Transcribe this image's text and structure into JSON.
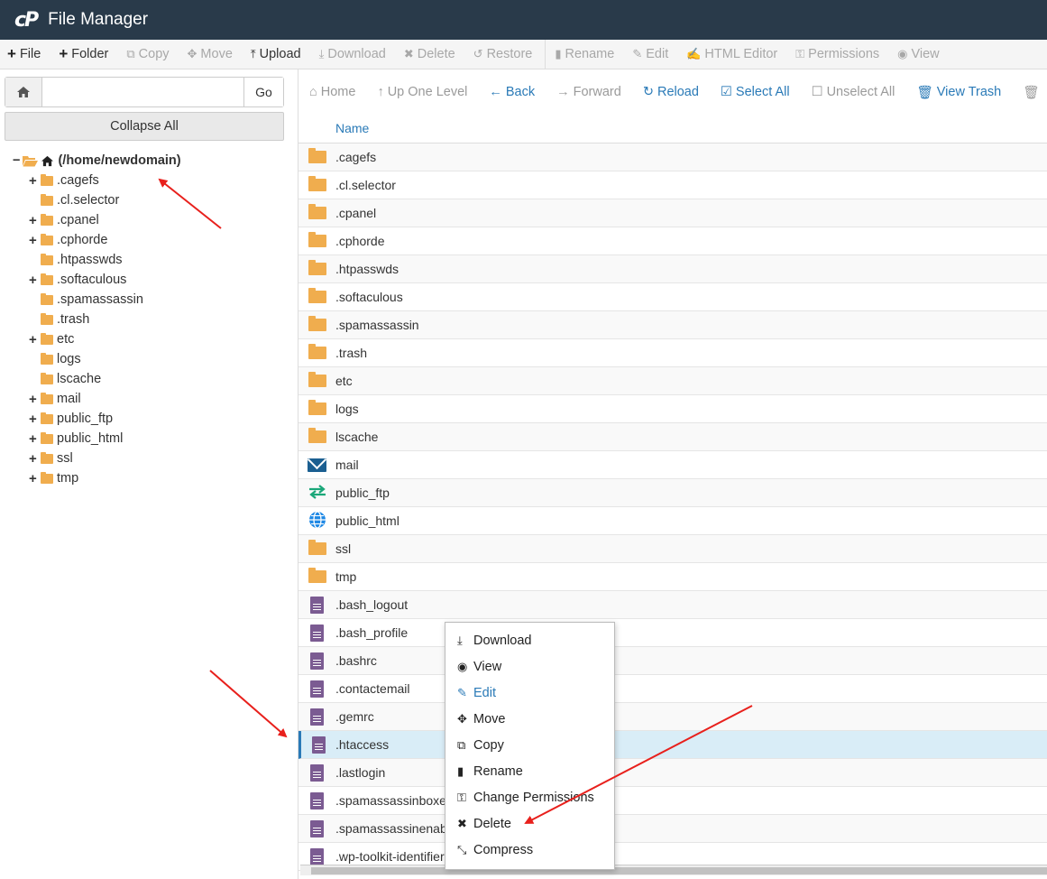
{
  "app": {
    "logo": "cP",
    "title": "File Manager"
  },
  "toolbar": [
    {
      "label": "File",
      "icon": "+",
      "disabled": false,
      "name": "new-file-button"
    },
    {
      "label": "Folder",
      "icon": "+",
      "disabled": false,
      "name": "new-folder-button"
    },
    {
      "label": "Copy",
      "icon": "⧉",
      "disabled": true,
      "name": "copy-button"
    },
    {
      "label": "Move",
      "icon": "✥",
      "disabled": true,
      "name": "move-button"
    },
    {
      "label": "Upload",
      "icon": "⤒",
      "disabled": false,
      "name": "upload-button"
    },
    {
      "label": "Download",
      "icon": "⤓",
      "disabled": true,
      "name": "download-button"
    },
    {
      "label": "Delete",
      "icon": "✖",
      "disabled": true,
      "name": "delete-button"
    },
    {
      "label": "Restore",
      "icon": "↺",
      "disabled": true,
      "name": "restore-button"
    },
    {
      "label": "Rename",
      "icon": "▮",
      "disabled": true,
      "name": "rename-button"
    },
    {
      "label": "Edit",
      "icon": "✎",
      "disabled": true,
      "name": "edit-button"
    },
    {
      "label": "HTML Editor",
      "icon": "✍",
      "disabled": true,
      "name": "html-editor-button"
    },
    {
      "label": "Permissions",
      "icon": "⚿",
      "disabled": true,
      "name": "permissions-button"
    },
    {
      "label": "View",
      "icon": "◉",
      "disabled": true,
      "name": "view-button"
    }
  ],
  "pathbar": {
    "value": "",
    "go_label": "Go"
  },
  "collapse_label": "Collapse All",
  "tree": {
    "root_label": "(/home/newdomain)",
    "items": [
      {
        "label": ".cagefs",
        "expandable": true
      },
      {
        "label": ".cl.selector",
        "expandable": false
      },
      {
        "label": ".cpanel",
        "expandable": true
      },
      {
        "label": ".cphorde",
        "expandable": true
      },
      {
        "label": ".htpasswds",
        "expandable": false
      },
      {
        "label": ".softaculous",
        "expandable": true
      },
      {
        "label": ".spamassassin",
        "expandable": false
      },
      {
        "label": ".trash",
        "expandable": false
      },
      {
        "label": "etc",
        "expandable": true
      },
      {
        "label": "logs",
        "expandable": false
      },
      {
        "label": "lscache",
        "expandable": false
      },
      {
        "label": "mail",
        "expandable": true
      },
      {
        "label": "public_ftp",
        "expandable": true
      },
      {
        "label": "public_html",
        "expandable": true
      },
      {
        "label": "ssl",
        "expandable": true
      },
      {
        "label": "tmp",
        "expandable": true
      }
    ]
  },
  "navbar": [
    {
      "label": "Home",
      "icon": "⌂",
      "disabled": true,
      "name": "nav-home-button"
    },
    {
      "label": "Up One Level",
      "icon": "↑",
      "disabled": true,
      "name": "nav-up-button"
    },
    {
      "label": "Back",
      "icon": "←",
      "disabled": false,
      "name": "nav-back-button"
    },
    {
      "label": "Forward",
      "icon": "→",
      "disabled": true,
      "name": "nav-forward-button"
    },
    {
      "label": "Reload",
      "icon": "↻",
      "disabled": false,
      "name": "nav-reload-button"
    },
    {
      "label": "Select All",
      "icon": "☑",
      "disabled": false,
      "name": "nav-select-all-button"
    },
    {
      "label": "Unselect All",
      "icon": "☐",
      "disabled": true,
      "name": "nav-unselect-all-button"
    },
    {
      "label": "View Trash",
      "icon": "🗑",
      "disabled": false,
      "name": "nav-view-trash-button"
    },
    {
      "label": "",
      "icon": "🗑",
      "disabled": true,
      "name": "nav-empty-trash-button"
    }
  ],
  "table": {
    "header_name": "Name",
    "rows": [
      {
        "name": ".cagefs",
        "type": "folder"
      },
      {
        "name": ".cl.selector",
        "type": "folder"
      },
      {
        "name": ".cpanel",
        "type": "folder"
      },
      {
        "name": ".cphorde",
        "type": "folder"
      },
      {
        "name": ".htpasswds",
        "type": "folder"
      },
      {
        "name": ".softaculous",
        "type": "folder"
      },
      {
        "name": ".spamassassin",
        "type": "folder"
      },
      {
        "name": ".trash",
        "type": "folder"
      },
      {
        "name": "etc",
        "type": "folder"
      },
      {
        "name": "logs",
        "type": "folder"
      },
      {
        "name": "lscache",
        "type": "folder"
      },
      {
        "name": "mail",
        "type": "mail"
      },
      {
        "name": "public_ftp",
        "type": "ftp"
      },
      {
        "name": "public_html",
        "type": "web"
      },
      {
        "name": "ssl",
        "type": "folder"
      },
      {
        "name": "tmp",
        "type": "folder"
      },
      {
        "name": ".bash_logout",
        "type": "file"
      },
      {
        "name": ".bash_profile",
        "type": "file"
      },
      {
        "name": ".bashrc",
        "type": "file"
      },
      {
        "name": ".contactemail",
        "type": "file"
      },
      {
        "name": ".gemrc",
        "type": "file"
      },
      {
        "name": ".htaccess",
        "type": "file",
        "selected": true
      },
      {
        "name": ".lastlogin",
        "type": "file"
      },
      {
        "name": ".spamassassinboxe",
        "type": "file"
      },
      {
        "name": ".spamassassinenab",
        "type": "file"
      },
      {
        "name": ".wp-toolkit-identifier",
        "type": "file"
      }
    ]
  },
  "context_menu": [
    {
      "label": "Download",
      "icon": "⤓",
      "name": "ctx-download"
    },
    {
      "label": "View",
      "icon": "◉",
      "name": "ctx-view"
    },
    {
      "label": "Edit",
      "icon": "✎",
      "name": "ctx-edit",
      "active": true
    },
    {
      "label": "Move",
      "icon": "✥",
      "name": "ctx-move"
    },
    {
      "label": "Copy",
      "icon": "⧉",
      "name": "ctx-copy"
    },
    {
      "label": "Rename",
      "icon": "▮",
      "name": "ctx-rename"
    },
    {
      "label": "Change Permissions",
      "icon": "⚿",
      "name": "ctx-change-permissions"
    },
    {
      "label": "Delete",
      "icon": "✖",
      "name": "ctx-delete"
    },
    {
      "label": "Compress",
      "icon": "⤡",
      "name": "ctx-compress"
    }
  ],
  "colors": {
    "titlebar": "#293a4a",
    "accent": "#2a7ab7",
    "folder": "#f0ad4e",
    "file": "#7b5b92",
    "annotation_arrow": "#e8201c"
  }
}
